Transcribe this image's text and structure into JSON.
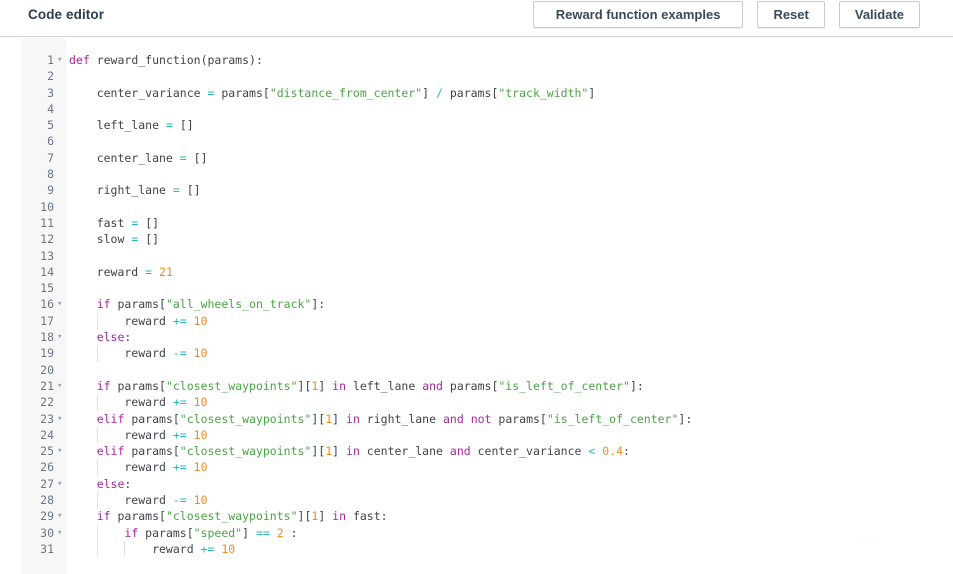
{
  "header": {
    "title": "Code editor",
    "buttons": [
      {
        "label": "Reward function examples",
        "name": "reward-function-examples-button"
      },
      {
        "label": "Reset",
        "name": "reset-button"
      },
      {
        "label": "Validate",
        "name": "validate-button"
      }
    ]
  },
  "editor": {
    "language": "python",
    "first_line": 1,
    "last_visible_line": 31,
    "colors": {
      "keyword": "#a626a4",
      "string": "#4aa544",
      "number": "#f28b22",
      "operator": "#2bb7b7",
      "identifier": "#3f4549",
      "gutter_bg": "#f7f7f7",
      "line_number": "#6b7785",
      "background": "#ffffff"
    },
    "lines": [
      {
        "n": 1,
        "fold": true,
        "tokens": [
          {
            "t": "def",
            "c": "kw"
          },
          {
            "t": " reward_function",
            "c": "id"
          },
          {
            "t": "(params):",
            "c": "pun"
          }
        ]
      },
      {
        "n": 2,
        "fold": false,
        "tokens": []
      },
      {
        "n": 3,
        "fold": false,
        "tokens": [
          {
            "t": "    center_variance ",
            "c": "id"
          },
          {
            "t": "=",
            "c": "op"
          },
          {
            "t": " params[",
            "c": "id"
          },
          {
            "t": "\"distance_from_center\"",
            "c": "str"
          },
          {
            "t": "] ",
            "c": "pun"
          },
          {
            "t": "/",
            "c": "op"
          },
          {
            "t": " params[",
            "c": "id"
          },
          {
            "t": "\"track_width\"",
            "c": "str"
          },
          {
            "t": "]",
            "c": "pun"
          }
        ]
      },
      {
        "n": 4,
        "fold": false,
        "tokens": []
      },
      {
        "n": 5,
        "fold": false,
        "tokens": [
          {
            "t": "    left_lane ",
            "c": "id"
          },
          {
            "t": "=",
            "c": "op"
          },
          {
            "t": " ",
            "c": "id"
          },
          {
            "t": "[]",
            "c": "box"
          }
        ]
      },
      {
        "n": 6,
        "fold": false,
        "tokens": []
      },
      {
        "n": 7,
        "fold": false,
        "tokens": [
          {
            "t": "    center_lane ",
            "c": "id"
          },
          {
            "t": "=",
            "c": "op"
          },
          {
            "t": " ",
            "c": "id"
          },
          {
            "t": "[]",
            "c": "box"
          }
        ]
      },
      {
        "n": 8,
        "fold": false,
        "tokens": []
      },
      {
        "n": 9,
        "fold": false,
        "tokens": [
          {
            "t": "    right_lane ",
            "c": "id"
          },
          {
            "t": "=",
            "c": "op"
          },
          {
            "t": " ",
            "c": "id"
          },
          {
            "t": "[]",
            "c": "box"
          }
        ]
      },
      {
        "n": 10,
        "fold": false,
        "tokens": []
      },
      {
        "n": 11,
        "fold": false,
        "tokens": [
          {
            "t": "    fast ",
            "c": "id"
          },
          {
            "t": "=",
            "c": "op"
          },
          {
            "t": " ",
            "c": "id"
          },
          {
            "t": "[]",
            "c": "box"
          }
        ]
      },
      {
        "n": 12,
        "fold": false,
        "tokens": [
          {
            "t": "    slow ",
            "c": "id"
          },
          {
            "t": "=",
            "c": "op"
          },
          {
            "t": " ",
            "c": "id"
          },
          {
            "t": "[]",
            "c": "box"
          }
        ]
      },
      {
        "n": 13,
        "fold": false,
        "tokens": []
      },
      {
        "n": 14,
        "fold": false,
        "tokens": [
          {
            "t": "    reward ",
            "c": "id"
          },
          {
            "t": "=",
            "c": "op"
          },
          {
            "t": " ",
            "c": "id"
          },
          {
            "t": "21",
            "c": "num"
          }
        ]
      },
      {
        "n": 15,
        "fold": false,
        "tokens": []
      },
      {
        "n": 16,
        "fold": true,
        "tokens": [
          {
            "t": "    ",
            "c": "id"
          },
          {
            "t": "if",
            "c": "kw"
          },
          {
            "t": " params[",
            "c": "id"
          },
          {
            "t": "\"all_wheels_on_track\"",
            "c": "str"
          },
          {
            "t": "]:",
            "c": "pun"
          }
        ]
      },
      {
        "n": 17,
        "fold": false,
        "guides": [
          1
        ],
        "tokens": [
          {
            "t": "        reward ",
            "c": "id"
          },
          {
            "t": "+=",
            "c": "op"
          },
          {
            "t": " ",
            "c": "id"
          },
          {
            "t": "10",
            "c": "num"
          }
        ]
      },
      {
        "n": 18,
        "fold": true,
        "tokens": [
          {
            "t": "    ",
            "c": "id"
          },
          {
            "t": "else",
            "c": "kw"
          },
          {
            "t": ":",
            "c": "pun"
          }
        ]
      },
      {
        "n": 19,
        "fold": false,
        "guides": [
          1
        ],
        "tokens": [
          {
            "t": "        reward ",
            "c": "id"
          },
          {
            "t": "-=",
            "c": "op"
          },
          {
            "t": " ",
            "c": "id"
          },
          {
            "t": "10",
            "c": "num"
          }
        ]
      },
      {
        "n": 20,
        "fold": false,
        "tokens": []
      },
      {
        "n": 21,
        "fold": true,
        "tokens": [
          {
            "t": "    ",
            "c": "id"
          },
          {
            "t": "if",
            "c": "kw"
          },
          {
            "t": " params[",
            "c": "id"
          },
          {
            "t": "\"closest_waypoints\"",
            "c": "str"
          },
          {
            "t": "][",
            "c": "pun"
          },
          {
            "t": "1",
            "c": "num"
          },
          {
            "t": "] ",
            "c": "pun"
          },
          {
            "t": "in",
            "c": "kw"
          },
          {
            "t": " left_lane ",
            "c": "id"
          },
          {
            "t": "and",
            "c": "kw"
          },
          {
            "t": " params[",
            "c": "id"
          },
          {
            "t": "\"is_left_of_center\"",
            "c": "str"
          },
          {
            "t": "]:",
            "c": "pun"
          }
        ]
      },
      {
        "n": 22,
        "fold": false,
        "guides": [
          1
        ],
        "tokens": [
          {
            "t": "        reward ",
            "c": "id"
          },
          {
            "t": "+=",
            "c": "op"
          },
          {
            "t": " ",
            "c": "id"
          },
          {
            "t": "10",
            "c": "num"
          }
        ]
      },
      {
        "n": 23,
        "fold": true,
        "tokens": [
          {
            "t": "    ",
            "c": "id"
          },
          {
            "t": "elif",
            "c": "kw"
          },
          {
            "t": " params[",
            "c": "id"
          },
          {
            "t": "\"closest_waypoints\"",
            "c": "str"
          },
          {
            "t": "][",
            "c": "pun"
          },
          {
            "t": "1",
            "c": "num"
          },
          {
            "t": "] ",
            "c": "pun"
          },
          {
            "t": "in",
            "c": "kw"
          },
          {
            "t": " right_lane ",
            "c": "id"
          },
          {
            "t": "and",
            "c": "kw"
          },
          {
            "t": " ",
            "c": "id"
          },
          {
            "t": "not",
            "c": "kw"
          },
          {
            "t": " params[",
            "c": "id"
          },
          {
            "t": "\"is_left_of_center\"",
            "c": "str"
          },
          {
            "t": "]:",
            "c": "pun"
          }
        ]
      },
      {
        "n": 24,
        "fold": false,
        "guides": [
          1
        ],
        "tokens": [
          {
            "t": "        reward ",
            "c": "id"
          },
          {
            "t": "+=",
            "c": "op"
          },
          {
            "t": " ",
            "c": "id"
          },
          {
            "t": "10",
            "c": "num"
          }
        ]
      },
      {
        "n": 25,
        "fold": true,
        "tokens": [
          {
            "t": "    ",
            "c": "id"
          },
          {
            "t": "elif",
            "c": "kw"
          },
          {
            "t": " params[",
            "c": "id"
          },
          {
            "t": "\"closest_waypoints\"",
            "c": "str"
          },
          {
            "t": "][",
            "c": "pun"
          },
          {
            "t": "1",
            "c": "num"
          },
          {
            "t": "] ",
            "c": "pun"
          },
          {
            "t": "in",
            "c": "kw"
          },
          {
            "t": " center_lane ",
            "c": "id"
          },
          {
            "t": "and",
            "c": "kw"
          },
          {
            "t": " center_variance ",
            "c": "id"
          },
          {
            "t": "<",
            "c": "op"
          },
          {
            "t": " ",
            "c": "id"
          },
          {
            "t": "0.4",
            "c": "num"
          },
          {
            "t": ":",
            "c": "pun"
          }
        ]
      },
      {
        "n": 26,
        "fold": false,
        "guides": [
          1
        ],
        "tokens": [
          {
            "t": "        reward ",
            "c": "id"
          },
          {
            "t": "+=",
            "c": "op"
          },
          {
            "t": " ",
            "c": "id"
          },
          {
            "t": "10",
            "c": "num"
          }
        ]
      },
      {
        "n": 27,
        "fold": true,
        "tokens": [
          {
            "t": "    ",
            "c": "id"
          },
          {
            "t": "else",
            "c": "kw"
          },
          {
            "t": ":",
            "c": "pun"
          }
        ]
      },
      {
        "n": 28,
        "fold": false,
        "guides": [
          1
        ],
        "tokens": [
          {
            "t": "        reward ",
            "c": "id"
          },
          {
            "t": "-=",
            "c": "op"
          },
          {
            "t": " ",
            "c": "id"
          },
          {
            "t": "10",
            "c": "num"
          }
        ]
      },
      {
        "n": 29,
        "fold": true,
        "tokens": [
          {
            "t": "    ",
            "c": "id"
          },
          {
            "t": "if",
            "c": "kw"
          },
          {
            "t": " params[",
            "c": "id"
          },
          {
            "t": "\"closest_waypoints\"",
            "c": "str"
          },
          {
            "t": "][",
            "c": "pun"
          },
          {
            "t": "1",
            "c": "num"
          },
          {
            "t": "] ",
            "c": "pun"
          },
          {
            "t": "in",
            "c": "kw"
          },
          {
            "t": " fast:",
            "c": "id"
          }
        ]
      },
      {
        "n": 30,
        "fold": true,
        "guides": [
          1
        ],
        "tokens": [
          {
            "t": "        ",
            "c": "id"
          },
          {
            "t": "if",
            "c": "kw"
          },
          {
            "t": " params[",
            "c": "id"
          },
          {
            "t": "\"speed\"",
            "c": "str"
          },
          {
            "t": "] ",
            "c": "pun"
          },
          {
            "t": "==",
            "c": "op"
          },
          {
            "t": " ",
            "c": "id"
          },
          {
            "t": "2",
            "c": "num"
          },
          {
            "t": " :",
            "c": "pun"
          }
        ]
      },
      {
        "n": 31,
        "fold": false,
        "guides": [
          1,
          2
        ],
        "tokens": [
          {
            "t": "            reward ",
            "c": "id"
          },
          {
            "t": "+=",
            "c": "op"
          },
          {
            "t": " ",
            "c": "id"
          },
          {
            "t": "10",
            "c": "num"
          }
        ]
      }
    ]
  }
}
